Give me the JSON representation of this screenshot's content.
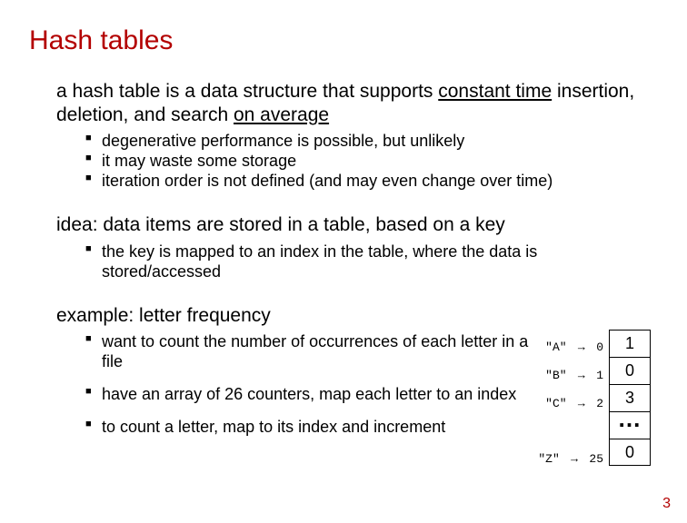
{
  "title": "Hash tables",
  "para1": {
    "pre": "a hash table is a data structure that supports ",
    "u1": "constant time",
    "mid": " insertion, deletion, and search ",
    "u2": "on average"
  },
  "bul1": {
    "a": "degenerative performance is possible, but unlikely",
    "b": "it may waste some storage",
    "c": "iteration order is not defined (and may even change over time)"
  },
  "para2": "idea: data items are stored in a table, based on a key",
  "bul2": {
    "a": "the key is mapped to an index in the table, where the data is stored/accessed"
  },
  "para3": "example: letter frequency",
  "bul3": {
    "a": "want to count the number of occurrences of each letter in a file",
    "b": "have an array of 26 counters, map each letter to an index",
    "c": "to count a letter, map to its index and increment"
  },
  "map": {
    "r0k": "\"A\"",
    "r0i": "0",
    "r1k": "\"B\"",
    "r1i": "1",
    "r2k": "\"C\"",
    "r2i": "2",
    "r3k": "\"Z\"",
    "r3i": "25"
  },
  "arr": {
    "v0": "1",
    "v1": "0",
    "v2": "3",
    "v3": "…",
    "v4": "0"
  },
  "page": "3"
}
